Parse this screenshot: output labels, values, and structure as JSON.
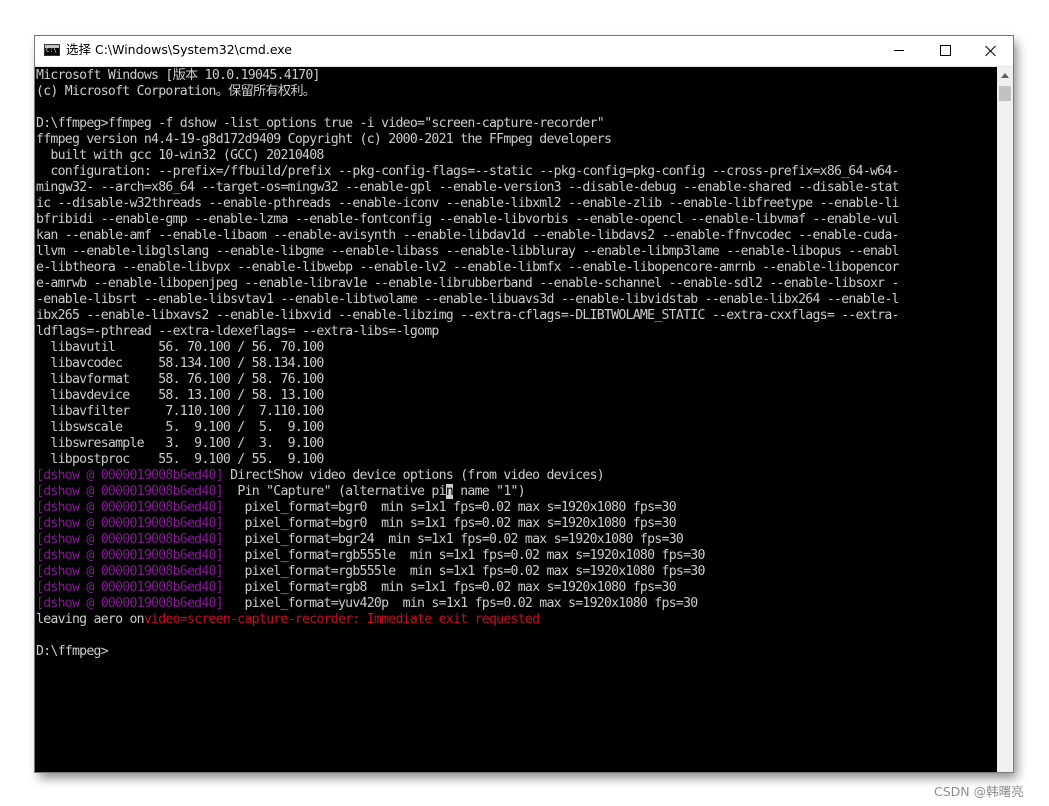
{
  "window": {
    "title": "选择 C:\\Windows\\System32\\cmd.exe",
    "icon": "cmd-icon"
  },
  "console": {
    "lines": [
      {
        "text": "Microsoft Windows [版本 10.0.19045.4170]"
      },
      {
        "text": "(c) Microsoft Corporation。保留所有权利。"
      },
      {
        "text": ""
      },
      {
        "text": "D:\\ffmpeg>ffmpeg -f dshow -list_options true -i video=\"screen-capture-recorder\""
      },
      {
        "text": "ffmpeg version n4.4-19-g8d172d9409 Copyright (c) 2000-2021 the FFmpeg developers"
      },
      {
        "text": "  built with gcc 10-win32 (GCC) 20210408"
      },
      {
        "text": "  configuration: --prefix=/ffbuild/prefix --pkg-config-flags=--static --pkg-config=pkg-config --cross-prefix=x86_64-w64-"
      },
      {
        "text": "mingw32- --arch=x86_64 --target-os=mingw32 --enable-gpl --enable-version3 --disable-debug --enable-shared --disable-stat"
      },
      {
        "text": "ic --disable-w32threads --enable-pthreads --enable-iconv --enable-libxml2 --enable-zlib --enable-libfreetype --enable-li"
      },
      {
        "text": "bfribidi --enable-gmp --enable-lzma --enable-fontconfig --enable-libvorbis --enable-opencl --enable-libvmaf --enable-vul"
      },
      {
        "text": "kan --enable-amf --enable-libaom --enable-avisynth --enable-libdav1d --enable-libdavs2 --enable-ffnvcodec --enable-cuda-"
      },
      {
        "text": "llvm --enable-libglslang --enable-libgme --enable-libass --enable-libbluray --enable-libmp3lame --enable-libopus --enabl"
      },
      {
        "text": "e-libtheora --enable-libvpx --enable-libwebp --enable-lv2 --enable-libmfx --enable-libopencore-amrnb --enable-libopencor"
      },
      {
        "text": "e-amrwb --enable-libopenjpeg --enable-librav1e --enable-librubberband --enable-schannel --enable-sdl2 --enable-libsoxr -"
      },
      {
        "text": "-enable-libsrt --enable-libsvtav1 --enable-libtwolame --enable-libuavs3d --enable-libvidstab --enable-libx264 --enable-l"
      },
      {
        "text": "ibx265 --enable-libxavs2 --enable-libxvid --enable-libzimg --extra-cflags=-DLIBTWOLAME_STATIC --extra-cxxflags= --extra-"
      },
      {
        "text": "ldflags=-pthread --extra-ldexeflags= --extra-libs=-lgomp"
      },
      {
        "text": "  libavutil      56. 70.100 / 56. 70.100"
      },
      {
        "text": "  libavcodec     58.134.100 / 58.134.100"
      },
      {
        "text": "  libavformat    58. 76.100 / 58. 76.100"
      },
      {
        "text": "  libavdevice    58. 13.100 / 58. 13.100"
      },
      {
        "text": "  libavfilter     7.110.100 /  7.110.100"
      },
      {
        "text": "  libswscale      5.  9.100 /  5.  9.100"
      },
      {
        "text": "  libswresample   3.  9.100 /  3.  9.100"
      },
      {
        "text": "  libpostproc    55.  9.100 / 55.  9.100"
      },
      {
        "tag": "[dshow @ 0000019008b6ed40]",
        "text": " DirectShow video device options (from video devices)"
      },
      {
        "tag": "[dshow @ 0000019008b6ed40]",
        "text": "  Pin \"Capture\" (alternative pi",
        "cursor": "n",
        "after": " name \"1\")"
      },
      {
        "tag": "[dshow @ 0000019008b6ed40]",
        "text": "   pixel_format=bgr0  min s=1x1 fps=0.02 max s=1920x1080 fps=30"
      },
      {
        "tag": "[dshow @ 0000019008b6ed40]",
        "text": "   pixel_format=bgr0  min s=1x1 fps=0.02 max s=1920x1080 fps=30"
      },
      {
        "tag": "[dshow @ 0000019008b6ed40]",
        "text": "   pixel_format=bgr24  min s=1x1 fps=0.02 max s=1920x1080 fps=30"
      },
      {
        "tag": "[dshow @ 0000019008b6ed40]",
        "text": "   pixel_format=rgb555le  min s=1x1 fps=0.02 max s=1920x1080 fps=30"
      },
      {
        "tag": "[dshow @ 0000019008b6ed40]",
        "text": "   pixel_format=rgb555le  min s=1x1 fps=0.02 max s=1920x1080 fps=30"
      },
      {
        "tag": "[dshow @ 0000019008b6ed40]",
        "text": "   pixel_format=rgb8  min s=1x1 fps=0.02 max s=1920x1080 fps=30"
      },
      {
        "tag": "[dshow @ 0000019008b6ed40]",
        "text": "   pixel_format=yuv420p  min s=1x1 fps=0.02 max s=1920x1080 fps=30"
      },
      {
        "text": "leaving aero on",
        "err": "video=screen-capture-recorder: Immediate exit requested"
      },
      {
        "text": ""
      },
      {
        "text": "D:\\ffmpeg>"
      }
    ]
  },
  "watermark": "CSDN @韩曙亮",
  "colors": {
    "console_bg": "#000000",
    "console_fg": "#cccccc",
    "tag": "#881798",
    "error": "#c50f1f"
  }
}
